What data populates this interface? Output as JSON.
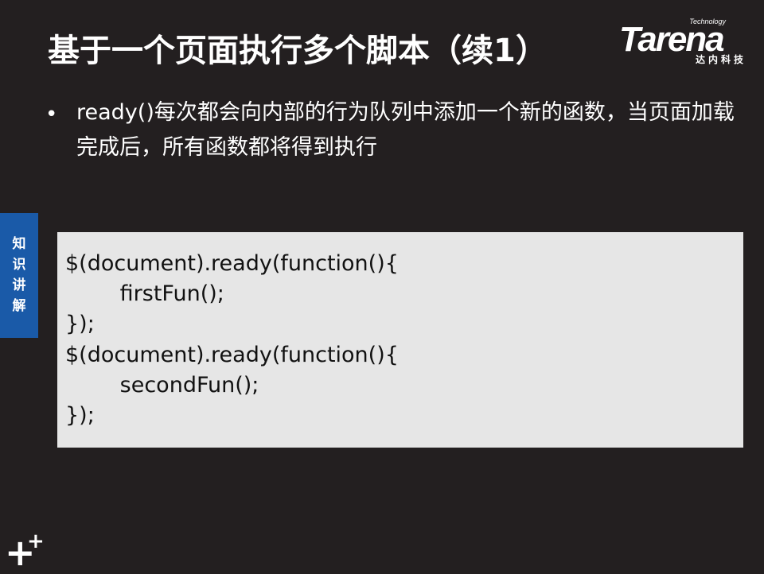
{
  "slide": {
    "title": "基于一个页面执行多个脚本（续1）",
    "bullet": "ready()每次都会向内部的行为队列中添加一个新的函数，当页面加载完成后，所有函数都将得到执行"
  },
  "logo": {
    "tagline": "Technology",
    "wordmark": "Tarena",
    "chinese": "达内科技"
  },
  "side_tab": {
    "chars": [
      "知",
      "识",
      "讲",
      "解"
    ]
  },
  "code": {
    "lines": [
      "$(document).ready(function(){",
      "        firstFun();",
      "});",
      "$(document).ready(function(){",
      "        secondFun();",
      "});"
    ]
  },
  "colors": {
    "background": "#231f20",
    "side_tab": "#1a5aa8",
    "code_bg": "#e6e6e6"
  },
  "icons": {
    "corner": "plus-plus-icon"
  }
}
